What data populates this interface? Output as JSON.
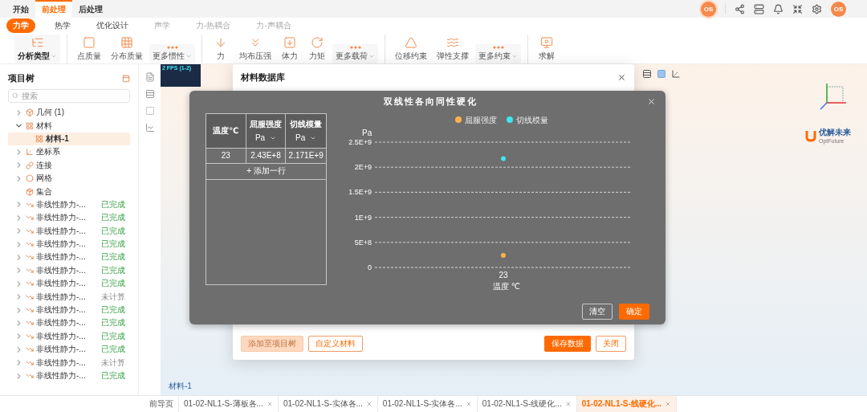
{
  "top_tabs": [
    {
      "label": "开始",
      "selected": false
    },
    {
      "label": "前处理",
      "selected": true
    },
    {
      "label": "后处理",
      "selected": false
    }
  ],
  "header": {
    "badge_initials": "OS",
    "user_initials": "OS"
  },
  "sub_tabs": [
    {
      "label": "力学",
      "selected": true,
      "disabled": false
    },
    {
      "label": "热学",
      "selected": false,
      "disabled": false
    },
    {
      "label": "优化设计",
      "selected": false,
      "disabled": false
    },
    {
      "label": "声学",
      "selected": false,
      "disabled": true
    },
    {
      "label": "力-热耦合",
      "selected": false,
      "disabled": true
    },
    {
      "label": "力-声耦合",
      "selected": false,
      "disabled": true
    }
  ],
  "toolbar_groups": [
    [
      {
        "label": "分析类型",
        "kind": "select"
      }
    ],
    [
      {
        "label": "点质量",
        "kind": "button"
      },
      {
        "label": "分布质量",
        "kind": "button"
      },
      {
        "label": "更多惯性",
        "kind": "more"
      }
    ],
    [
      {
        "label": "力",
        "kind": "button"
      },
      {
        "label": "均布压强",
        "kind": "button"
      },
      {
        "label": "体力",
        "kind": "button"
      },
      {
        "label": "力矩",
        "kind": "button"
      },
      {
        "label": "更多载荷",
        "kind": "more"
      }
    ],
    [
      {
        "label": "位移约束",
        "kind": "button"
      },
      {
        "label": "弹性支撑",
        "kind": "button"
      },
      {
        "label": "更多约束",
        "kind": "more"
      }
    ],
    [
      {
        "label": "求解",
        "kind": "button"
      }
    ]
  ],
  "project_tree": {
    "title": "项目树",
    "search_placeholder": "搜索",
    "items": [
      {
        "label": "几何 (1)",
        "kind": "collapsed",
        "selected": false
      },
      {
        "label": "材料",
        "kind": "expanded",
        "selected": false,
        "children": [
          {
            "label": "材料-1",
            "kind": "leaf",
            "selected": true
          }
        ]
      },
      {
        "label": "坐标系",
        "kind": "collapsed",
        "selected": false
      },
      {
        "label": "连接",
        "kind": "collapsed",
        "selected": false
      },
      {
        "label": "网格",
        "kind": "collapsed",
        "selected": false
      },
      {
        "label": "集合",
        "kind": "leaf",
        "selected": false
      },
      {
        "label": "非线性静力-...",
        "kind": "collapsed",
        "selected": false,
        "status": "已完成",
        "done": true
      },
      {
        "label": "非线性静力-...",
        "kind": "collapsed",
        "selected": false,
        "status": "已完成",
        "done": true
      },
      {
        "label": "非线性静力-...",
        "kind": "collapsed",
        "selected": false,
        "status": "已完成",
        "done": true
      },
      {
        "label": "非线性静力-...",
        "kind": "collapsed",
        "selected": false,
        "status": "已完成",
        "done": true
      },
      {
        "label": "非线性静力-...",
        "kind": "collapsed",
        "selected": false,
        "status": "已完成",
        "done": true
      },
      {
        "label": "非线性静力-...",
        "kind": "collapsed",
        "selected": false,
        "status": "已完成",
        "done": true
      },
      {
        "label": "非线性静力-...",
        "kind": "collapsed",
        "selected": false,
        "status": "已完成",
        "done": true
      },
      {
        "label": "非线性静力-...",
        "kind": "collapsed",
        "selected": false,
        "status": "未计算",
        "done": false
      },
      {
        "label": "非线性静力-...",
        "kind": "collapsed",
        "selected": false,
        "status": "已完成",
        "done": true
      },
      {
        "label": "非线性静力-...",
        "kind": "collapsed",
        "selected": false,
        "status": "已完成",
        "done": true
      },
      {
        "label": "非线性静力-...",
        "kind": "collapsed",
        "selected": false,
        "status": "已完成",
        "done": true
      },
      {
        "label": "非线性静力-...",
        "kind": "collapsed",
        "selected": false,
        "status": "已完成",
        "done": true
      },
      {
        "label": "非线性静力-...",
        "kind": "collapsed",
        "selected": false,
        "status": "未计算",
        "done": false
      },
      {
        "label": "非线性静力-...",
        "kind": "collapsed",
        "selected": false,
        "status": "已完成",
        "done": true
      }
    ]
  },
  "viewport": {
    "fps_label": "2 FPS (1-2)",
    "material_label": "材料-1",
    "logo_name": "优解未来",
    "logo_tagline": "OptFuture"
  },
  "material_dialog": {
    "title": "材料数据库",
    "buttons": [
      {
        "label": "添加至项目树",
        "kind": "ghost",
        "disabled": true
      },
      {
        "label": "自定义材料",
        "kind": "outline",
        "disabled": false
      },
      {
        "label": "保存数据",
        "kind": "primary",
        "disabled": false
      },
      {
        "label": "关闭",
        "kind": "outline",
        "disabled": false
      }
    ]
  },
  "curve_dialog": {
    "title": "双线性各向同性硬化",
    "columns": [
      {
        "label": "温度℃"
      },
      {
        "label": "屈服强度",
        "unit": "Pa"
      },
      {
        "label": "切线模量",
        "unit": "Pa"
      }
    ],
    "rows": [
      [
        "23",
        "2.43E+8",
        "2.171E+9"
      ]
    ],
    "add_row": "+ 添加一行",
    "chart_data": {
      "type": "scatter",
      "legend": true,
      "xlabel": "温度 ℃",
      "ylabel": "Pa",
      "categories": [
        "23"
      ],
      "grid": true,
      "series": [
        {
          "name": "屈服强度",
          "color": "#ffb14e",
          "values": [
            240000000
          ]
        },
        {
          "name": "切线模量",
          "color": "#3fe6f5",
          "values": [
            2170000000
          ]
        }
      ],
      "ylim": [
        0,
        2500000000
      ],
      "yticks": [
        {
          "value": 0,
          "label": "0"
        },
        {
          "value": 500000000,
          "label": "5E+8"
        },
        {
          "value": 1000000000,
          "label": "1E+9"
        },
        {
          "value": 1500000000,
          "label": "1.5E+9"
        },
        {
          "value": 2000000000,
          "label": "2E+9"
        },
        {
          "value": 2500000000,
          "label": "2.5E+9"
        }
      ]
    },
    "buttons": [
      {
        "label": "清空",
        "kind": "outline"
      },
      {
        "label": "确定",
        "kind": "primary"
      }
    ]
  },
  "bottom_tabs": [
    {
      "label": "前导页",
      "selected": false,
      "closable": false
    },
    {
      "label": "01-02-NL1-S-薄板各...",
      "selected": false,
      "closable": true
    },
    {
      "label": "01-02-NL1-S-实体各...",
      "selected": false,
      "closable": true
    },
    {
      "label": "01-02-NL1-S-实体各...",
      "selected": false,
      "closable": true
    },
    {
      "label": "01-02-NL1-S-线硬化...",
      "selected": false,
      "closable": true
    },
    {
      "label": "01-02-NL1-S-线硬化...",
      "selected": true,
      "closable": true
    }
  ]
}
